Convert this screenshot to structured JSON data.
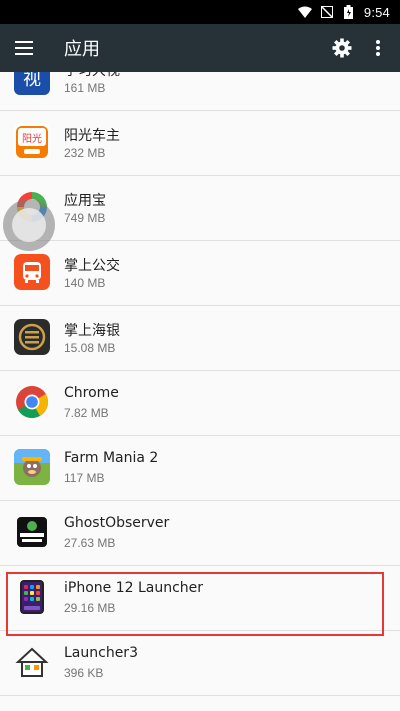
{
  "status_bar": {
    "time": "9:54"
  },
  "app_bar": {
    "title": "应用"
  },
  "apps": [
    {
      "name": "学习大视",
      "size": "161 MB",
      "icon": "xuexi-icon"
    },
    {
      "name": "阳光车主",
      "size": "232 MB",
      "icon": "yangguang-icon"
    },
    {
      "name": "应用宝",
      "size": "749 MB",
      "icon": "yingyongbao-icon"
    },
    {
      "name": "掌上公交",
      "size": "140 MB",
      "icon": "bus-icon"
    },
    {
      "name": "掌上海银",
      "size": "15.08 MB",
      "icon": "haiyin-icon"
    },
    {
      "name": "Chrome",
      "size": "7.82 MB",
      "icon": "chrome-icon"
    },
    {
      "name": "Farm Mania 2",
      "size": "117 MB",
      "icon": "farm-icon"
    },
    {
      "name": "GhostObserver",
      "size": "27.63 MB",
      "icon": "ghost-icon"
    },
    {
      "name": "iPhone 12 Launcher",
      "size": "29.16 MB",
      "icon": "iphone-launcher-icon"
    },
    {
      "name": "Launcher3",
      "size": "396 KB",
      "icon": "launcher3-icon"
    }
  ]
}
